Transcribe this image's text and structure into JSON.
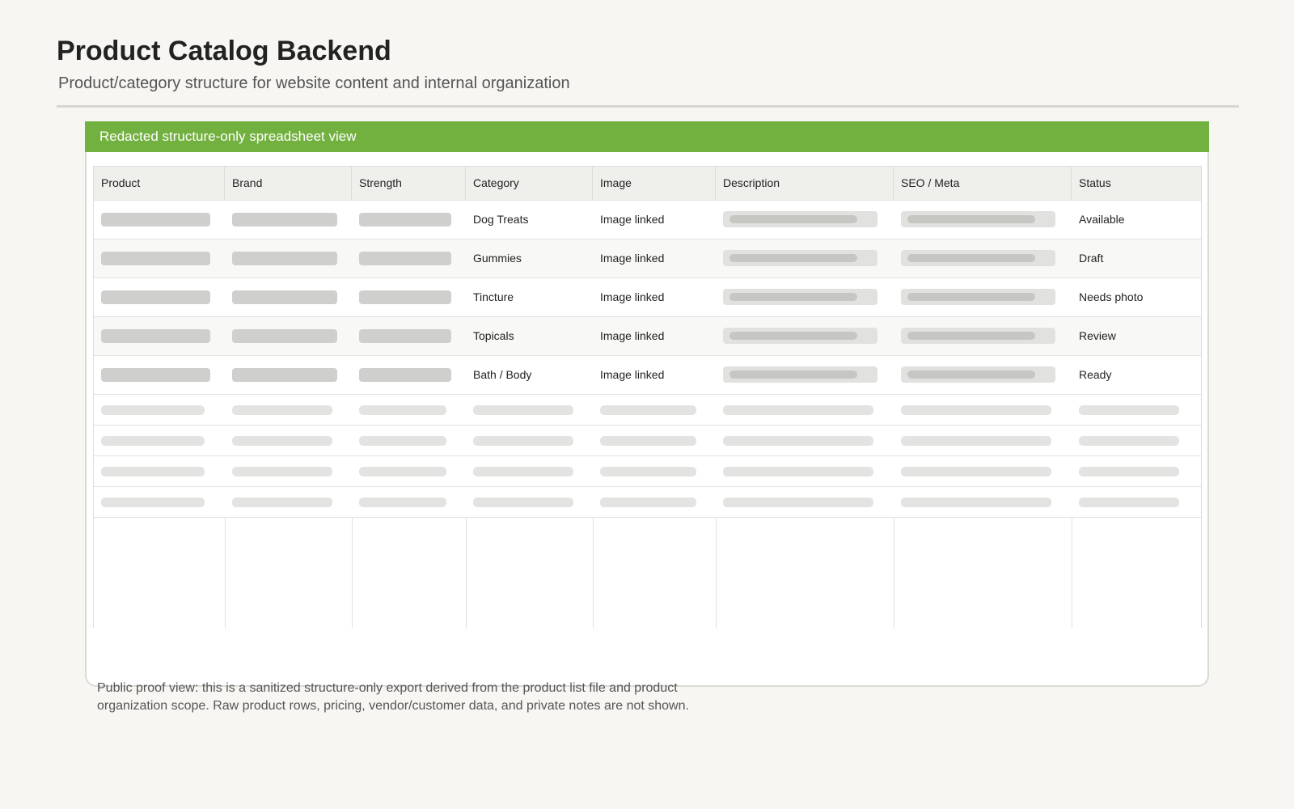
{
  "header": {
    "title": "Product Catalog Backend",
    "subtitle": "Product/category structure for website content and internal organization"
  },
  "sheet": {
    "banner": "Redacted structure-only spreadsheet view",
    "columns": [
      "Product",
      "Brand",
      "Strength",
      "Category",
      "Image",
      "Description",
      "SEO / Meta",
      "Status"
    ],
    "rows": [
      {
        "category": "Dog Treats",
        "image": "Image linked",
        "status": "Available"
      },
      {
        "category": "Gummies",
        "image": "Image linked",
        "status": "Draft"
      },
      {
        "category": "Tincture",
        "image": "Image linked",
        "status": "Needs photo"
      },
      {
        "category": "Topicals",
        "image": "Image linked",
        "status": "Review"
      },
      {
        "category": "Bath / Body",
        "image": "Image linked",
        "status": "Ready"
      }
    ]
  },
  "footer": {
    "note": "Public proof view: this is a sanitized structure-only export derived from the product list file and product organization scope. Raw product rows, pricing, vendor/customer data, and private notes are not shown."
  },
  "colors": {
    "accent": "#72b03f",
    "background": "#f7f6f2"
  }
}
